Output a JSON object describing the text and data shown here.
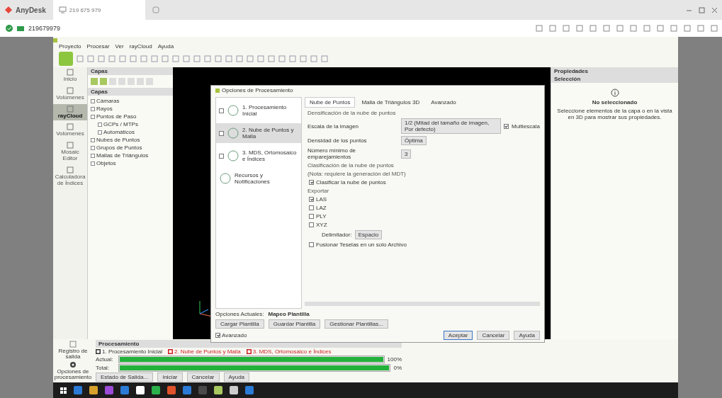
{
  "anydesk": {
    "app_name": "AnyDesk",
    "tab_address": "219 675 979",
    "session_id": "219679979"
  },
  "app": {
    "menu": [
      "Proyecto",
      "Procesar",
      "Ver",
      "rayCloud",
      "Ayuda"
    ],
    "nav": [
      {
        "label": "Inicio",
        "selected": false
      },
      {
        "label": "Volúmenes",
        "selected": false
      },
      {
        "label": "rayCloud",
        "selected": true
      },
      {
        "label": "Volúmenes",
        "selected": false
      },
      {
        "label": "Mosaic Editor",
        "selected": false
      },
      {
        "label": "Calculadora de Índices",
        "selected": false
      }
    ],
    "layers_title": "Capas",
    "tree_title": "Capas",
    "tree": [
      {
        "label": "Cámaras"
      },
      {
        "label": "Rayos"
      },
      {
        "label": "Puntos de Paso",
        "children": [
          {
            "label": "GCPs / MTPs"
          },
          {
            "label": "Automáticos"
          }
        ]
      },
      {
        "label": "Nubes de Puntos"
      },
      {
        "label": "Grupos de Puntos"
      },
      {
        "label": "Mallas de Triángulos"
      },
      {
        "label": "Objetos"
      }
    ],
    "properties": {
      "title": "Propiedades",
      "section": "Selección",
      "heading": "No seleccionado",
      "text": "Seleccione elementos de la capa o en la vista en 3D para mostrar sus propiedades."
    },
    "processing": {
      "title": "Procesamiento",
      "steps": [
        {
          "label": "1. Procesamiento Inicial",
          "color": "#333333"
        },
        {
          "label": "2. Nube de Puntos y Malla",
          "color": "#cc2222"
        },
        {
          "label": "3. MDS, Ortomosaico e Índices",
          "color": "#cc2222"
        }
      ],
      "bars": [
        {
          "label": "Actual:",
          "level": 1,
          "reading": "100%"
        },
        {
          "label": "Total:",
          "level": 1,
          "reading": "0%"
        }
      ],
      "buttons": [
        "Estado de Salida...",
        "Iniciar",
        "Cancelar",
        "Ayuda"
      ],
      "side": [
        {
          "label": "Registro de salida"
        },
        {
          "label": "Opciones de procesamiento"
        }
      ]
    }
  },
  "dialog": {
    "title": "Opciones de Procesamiento",
    "steps": [
      {
        "label": "1. Procesamiento Inicial",
        "selected": false,
        "checked": false
      },
      {
        "label": "2. Nube de Puntos y Malla",
        "selected": true,
        "checked": false
      },
      {
        "label": "3. MDS, Ortomosaico e Índices",
        "selected": false,
        "checked": false
      },
      {
        "label": "Recursos y Notificaciones",
        "selected": false
      }
    ],
    "tabs": [
      {
        "label": "Nube de Puntos",
        "selected": true
      },
      {
        "label": "Malla de Triángulos 3D",
        "selected": false
      },
      {
        "label": "Avanzado",
        "selected": false
      }
    ],
    "densify_title": "Densificación de la nube de puntos",
    "fields": [
      {
        "label": "Escala de la imagen",
        "value": "1/2 (Mitad del tamaño de imagen, Por defecto)",
        "extra": "Multiescala",
        "extra_checked": true
      },
      {
        "label": "Densidad de los puntos",
        "value": "Óptima"
      },
      {
        "label": "Número mínimo de emparejamientos",
        "value": "3"
      }
    ],
    "classify_title": "Clasificación de la nube de puntos",
    "classify_note": "(Nota: requiere la generación del MDT)",
    "classify": {
      "label": "Clasificar la nube de puntos",
      "checked": true
    },
    "export_title": "Exportar",
    "exports": [
      {
        "label": "LAS",
        "checked": true
      },
      {
        "label": "LAZ",
        "checked": false
      },
      {
        "label": "PLY",
        "checked": false
      },
      {
        "label": "XYZ",
        "checked": false
      }
    ],
    "delimiter": {
      "label": "Delimitador:",
      "value": "Espacio"
    },
    "merge": {
      "label": "Fusionar Teselas en un solo Archivo",
      "checked": false
    },
    "current_label": "Opciones Actuales:",
    "current_value": "Mapeo Plantilla",
    "template_buttons": [
      "Cargar Plantilla",
      "Guardar Plantilla",
      "Gestionar Plantillas..."
    ],
    "advanced": {
      "label": "Avanzado",
      "checked": true
    },
    "buttons": [
      {
        "label": "Aceptar",
        "kind": "default"
      },
      {
        "label": "Cancelar",
        "kind": "normal"
      },
      {
        "label": "Ayuda",
        "kind": "normal"
      }
    ]
  }
}
